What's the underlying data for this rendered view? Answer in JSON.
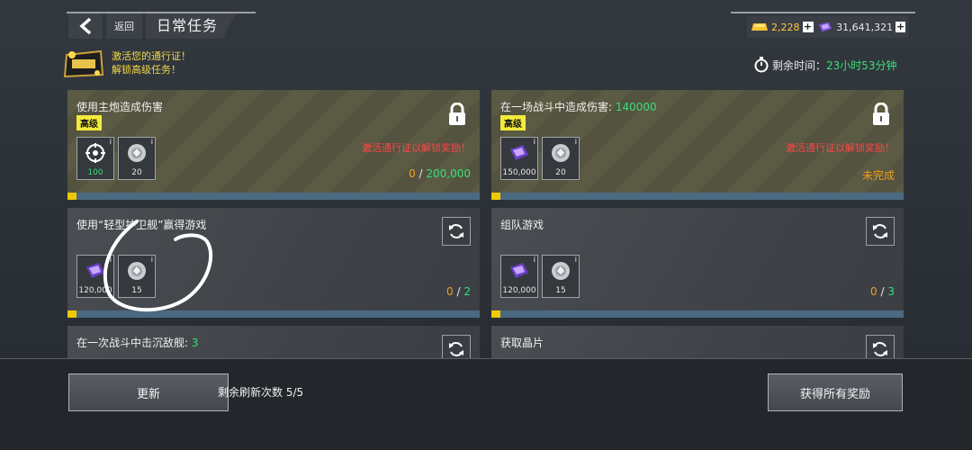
{
  "header": {
    "back_label": "返回",
    "title": "日常任务",
    "gold_amount": "2,228",
    "gem_amount": "31,641,321"
  },
  "promo": {
    "line1": "激活您的通行证！",
    "line2": "解锁高级任务！",
    "badge_icon": "battle-pass-badge-icon"
  },
  "timer": {
    "label": "剩余时间：",
    "value": "23小时53分钟"
  },
  "cards": [
    {
      "title": "使用主炮造成伤害",
      "tag": "高级",
      "rewards": [
        {
          "icon": "crosshair-icon",
          "qty": "100"
        },
        {
          "icon": "silver-coin-icon",
          "qty": "20"
        }
      ],
      "warning": "激活通行证以解锁奖励！",
      "progress_current": "0",
      "progress_sep": " / ",
      "progress_total": "200,000",
      "progress_fraction": 0
    },
    {
      "title_prefix": "在一场战斗中造成伤害: ",
      "title_num": "140000",
      "tag": "高级",
      "rewards": [
        {
          "icon": "crystal-ticket-icon",
          "qty": "150,000"
        },
        {
          "icon": "silver-coin-icon",
          "qty": "20"
        }
      ],
      "warning": "激活通行证以解锁奖励！",
      "status": "未完成",
      "progress_fraction": 0
    },
    {
      "title": "使用“轻型护卫舰”赢得游戏",
      "rewards": [
        {
          "icon": "crystal-ticket-icon",
          "qty": "120,000"
        },
        {
          "icon": "silver-coin-icon",
          "qty": "15"
        }
      ],
      "progress_current": "0",
      "progress_sep": " / ",
      "progress_total": "2",
      "progress_fraction": 0
    },
    {
      "title": "组队游戏",
      "rewards": [
        {
          "icon": "crystal-ticket-icon",
          "qty": "120,000"
        },
        {
          "icon": "silver-coin-icon",
          "qty": "15"
        }
      ],
      "progress_current": "0",
      "progress_sep": " / ",
      "progress_total": "3",
      "progress_fraction": 0
    },
    {
      "title_prefix": "在一次战斗中击沉敌舰: ",
      "title_num": "3"
    },
    {
      "title": "获取晶片"
    }
  ],
  "footer": {
    "refresh_button": "更新",
    "refresh_count": "剩余刷新次数 5/5",
    "claim_all_button": "获得所有奖励"
  },
  "colors": {
    "accent_green": "#39e07a",
    "warning_red": "#ff4545",
    "progress_yellow": "#f0c800",
    "orange": "#f0a020"
  }
}
